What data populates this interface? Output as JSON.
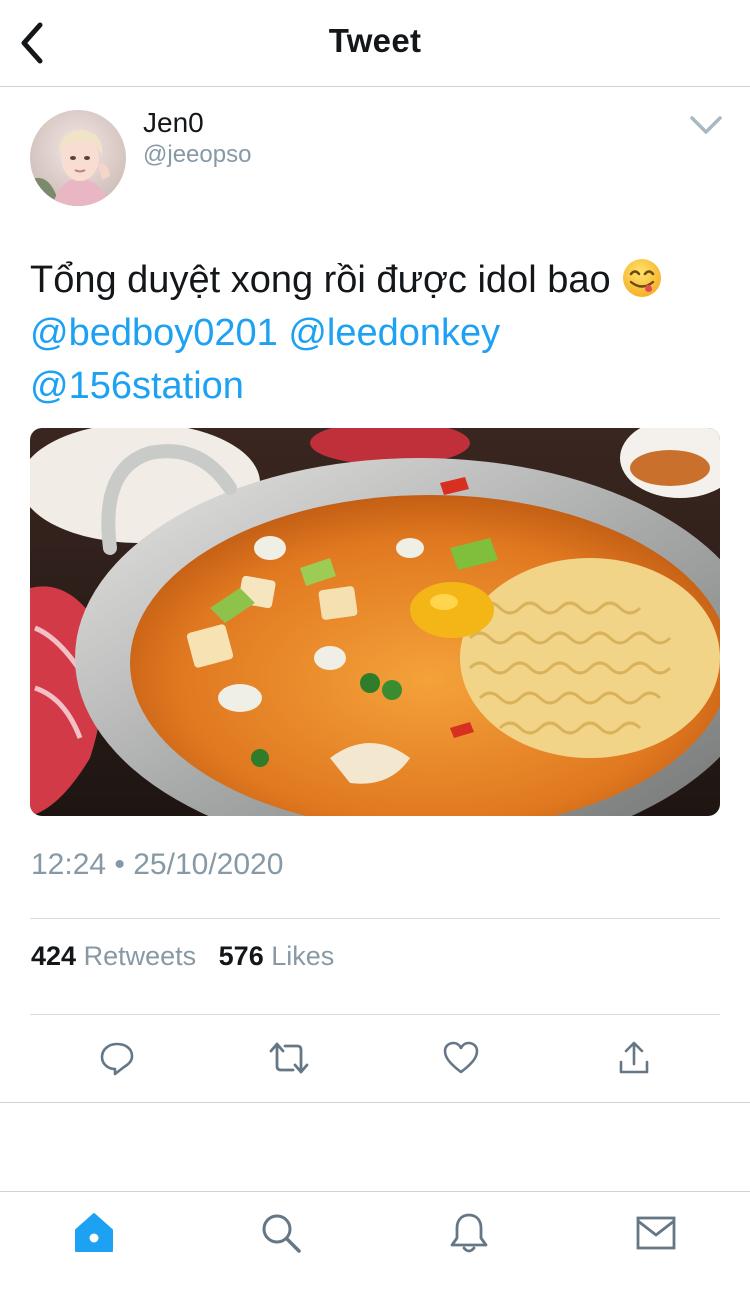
{
  "header": {
    "title": "Tweet",
    "back_icon": "chevron-left-icon"
  },
  "author": {
    "display_name": "Jen0",
    "handle": "@jeeopso"
  },
  "tweet": {
    "text": "Tổng duyệt xong rồi được idol bao",
    "emoji": "face-savoring-food-emoji",
    "mentions": [
      "@bedboy0201",
      "@leedonkey",
      "@156station"
    ],
    "timestamp": "12:24 • 25/10/2020"
  },
  "stats": {
    "retweets_count": "424",
    "retweets_label": "Retweets",
    "likes_count": "576",
    "likes_label": "Likes"
  },
  "actions": [
    "reply-icon",
    "retweet-icon",
    "like-icon",
    "share-icon"
  ],
  "tabbar": [
    "home-icon",
    "search-icon",
    "notifications-icon",
    "messages-icon"
  ],
  "colors": {
    "accent": "#1da1f2",
    "secondary_text": "#8899a6",
    "divider": "#d5dade"
  }
}
